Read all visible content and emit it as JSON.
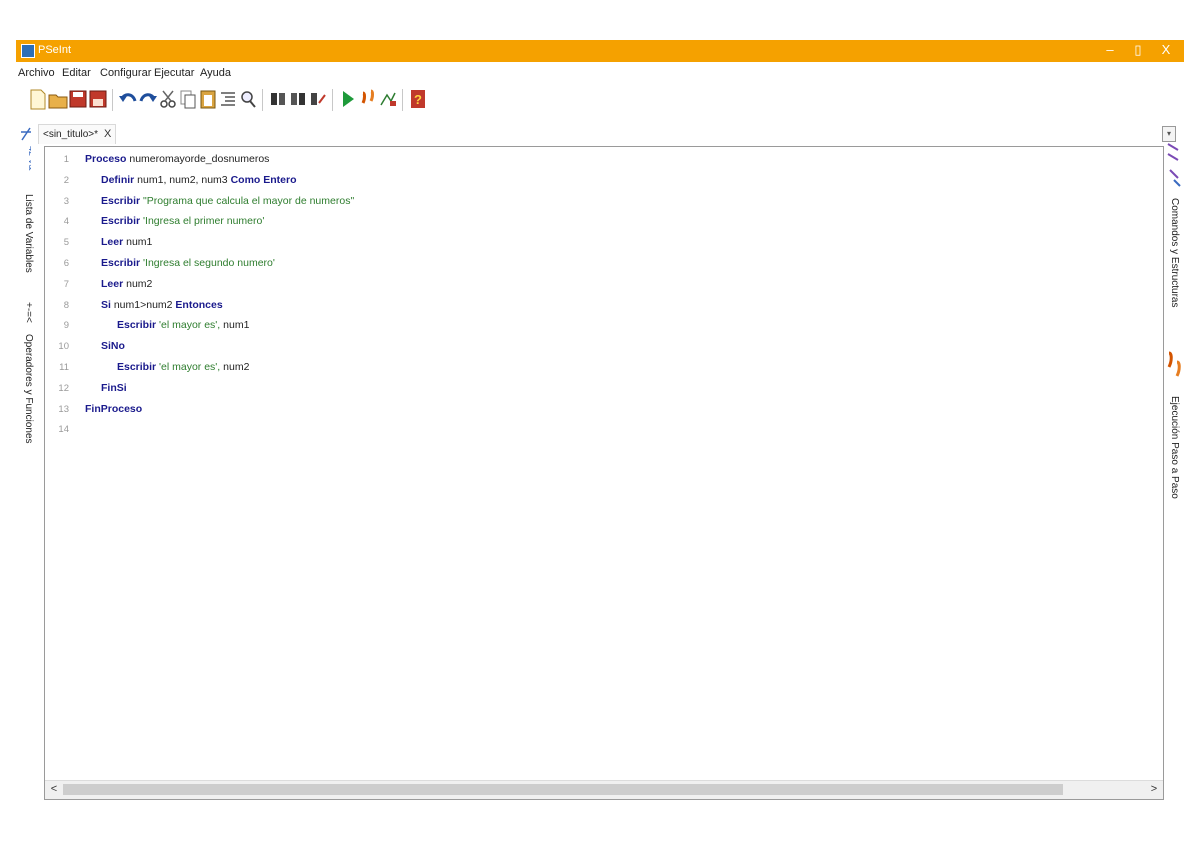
{
  "window": {
    "title": "PSeInt",
    "minimize_label": "–",
    "maximize_label": "▯",
    "close_label": "X"
  },
  "menu": {
    "items": [
      "Archivo",
      "Editar",
      "Configurar",
      "Ejecutar",
      "Ayuda"
    ]
  },
  "toolbar": {
    "icons": [
      "new-file-icon",
      "open-folder-icon",
      "save-icon",
      "save-as-icon",
      "undo-icon",
      "redo-icon",
      "cut-icon",
      "copy-icon",
      "paste-icon",
      "indent-icon",
      "find-icon",
      "search-prev-icon",
      "search-next-icon",
      "replace-icon",
      "run-icon",
      "step-icon",
      "draw-flowchart-icon",
      "help-icon"
    ]
  },
  "tab": {
    "label": "<sin_titulo>*",
    "close_label": "X"
  },
  "left_panel": {
    "variables_label": "Lista de Variables",
    "operators_label": "Operadores y Funciones",
    "operators_glyph": "+-=<"
  },
  "right_panel": {
    "commands_label": "Comandos y Estructuras",
    "step_label": "Ejecución Paso a Paso"
  },
  "editor": {
    "lines": [
      {
        "n": "1",
        "indent": 0,
        "tokens": [
          {
            "t": "Proceso",
            "k": "kw"
          },
          {
            "t": " numeromayorde_dosnumeros",
            "k": "id"
          }
        ]
      },
      {
        "n": "2",
        "indent": 1,
        "tokens": [
          {
            "t": "Definir",
            "k": "kw"
          },
          {
            "t": " num1, num2, num3 ",
            "k": "id"
          },
          {
            "t": "Como Entero",
            "k": "kw"
          }
        ]
      },
      {
        "n": "3",
        "indent": 1,
        "tokens": [
          {
            "t": "Escribir",
            "k": "kw"
          },
          {
            "t": " \"Programa que calcula el mayor de numeros\"",
            "k": "str"
          }
        ]
      },
      {
        "n": "4",
        "indent": 1,
        "tokens": [
          {
            "t": "Escribir",
            "k": "kw"
          },
          {
            "t": " 'Ingresa el primer numero'",
            "k": "str"
          }
        ]
      },
      {
        "n": "5",
        "indent": 1,
        "tokens": [
          {
            "t": "Leer",
            "k": "kw"
          },
          {
            "t": " num1",
            "k": "id"
          }
        ]
      },
      {
        "n": "6",
        "indent": 1,
        "tokens": [
          {
            "t": "Escribir",
            "k": "kw"
          },
          {
            "t": " 'Ingresa el segundo numero'",
            "k": "str"
          }
        ]
      },
      {
        "n": "7",
        "indent": 1,
        "tokens": [
          {
            "t": "Leer",
            "k": "kw"
          },
          {
            "t": " num2",
            "k": "id"
          }
        ]
      },
      {
        "n": "8",
        "indent": 1,
        "tokens": [
          {
            "t": "Si",
            "k": "kw"
          },
          {
            "t": " num1>num2 ",
            "k": "id"
          },
          {
            "t": "Entonces",
            "k": "kw"
          }
        ]
      },
      {
        "n": "9",
        "indent": 2,
        "tokens": [
          {
            "t": "Escribir",
            "k": "kw"
          },
          {
            "t": " 'el mayor es', ",
            "k": "str"
          },
          {
            "t": "num1",
            "k": "id"
          }
        ]
      },
      {
        "n": "10",
        "indent": 1,
        "tokens": [
          {
            "t": "SiNo",
            "k": "kw"
          }
        ]
      },
      {
        "n": "11",
        "indent": 2,
        "tokens": [
          {
            "t": "Escribir",
            "k": "kw"
          },
          {
            "t": " 'el mayor es', ",
            "k": "str"
          },
          {
            "t": "num2",
            "k": "id"
          }
        ]
      },
      {
        "n": "12",
        "indent": 1,
        "tokens": [
          {
            "t": "FinSi",
            "k": "kw"
          }
        ]
      },
      {
        "n": "13",
        "indent": 0,
        "tokens": [
          {
            "t": "FinProceso",
            "k": "kw"
          }
        ]
      },
      {
        "n": "14",
        "indent": 0,
        "tokens": []
      }
    ]
  },
  "scrollbar": {
    "left_arrow": "<",
    "right_arrow": ">"
  }
}
